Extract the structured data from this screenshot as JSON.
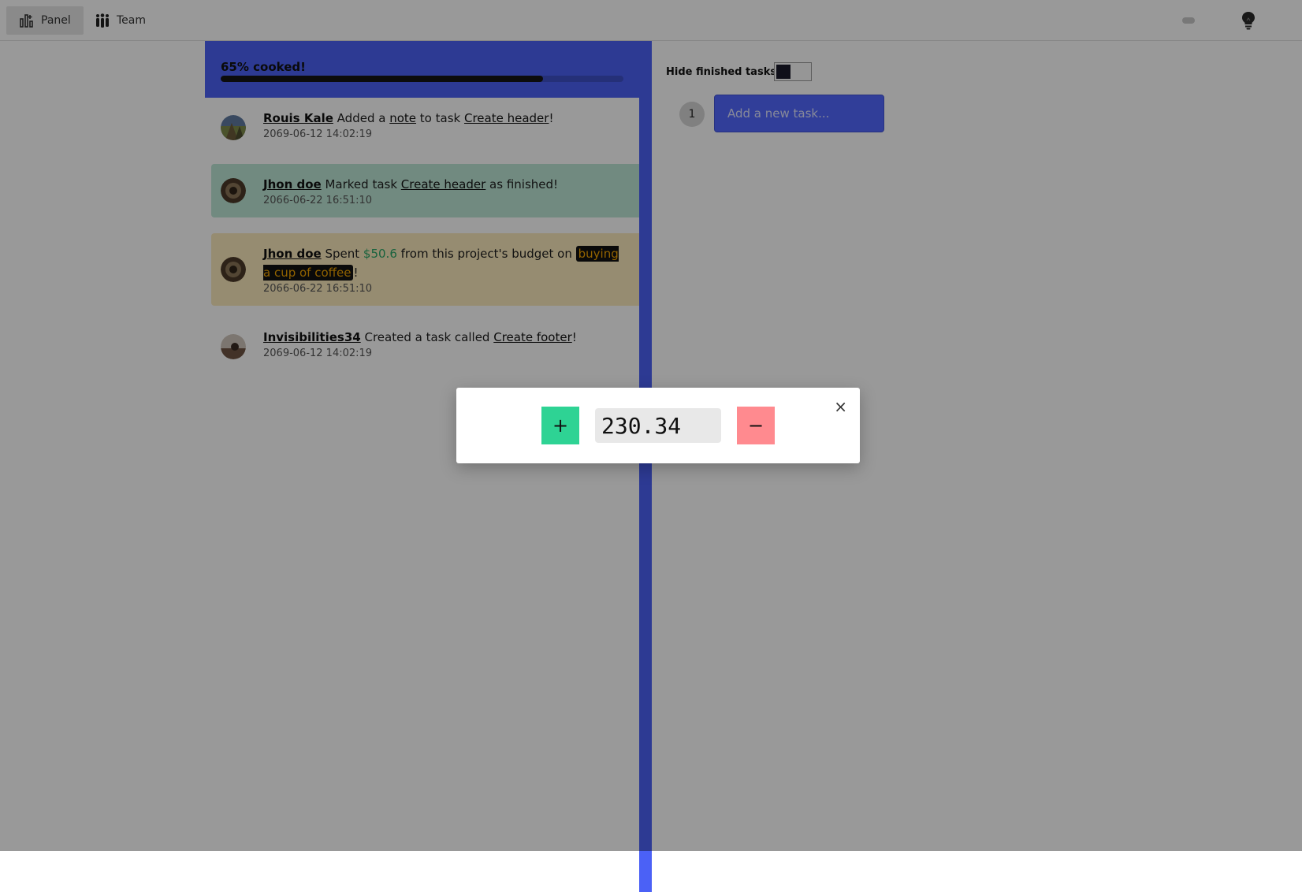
{
  "nav": {
    "items": [
      {
        "label": "Panel",
        "icon": "chart-bar-icon",
        "active": true
      },
      {
        "label": "Team",
        "icon": "team-icon",
        "active": false
      }
    ],
    "right_icons": [
      "toggle-pill-icon",
      "lightbulb-icon"
    ]
  },
  "progress": {
    "label": "65% cooked!",
    "fraction": 0.8
  },
  "feed": {
    "events": [
      {
        "user": "Rouis Kale",
        "pre": "Added a",
        "link1": "note",
        "mid": "to task",
        "link2": "Create header",
        "post": "!",
        "time": "2069-06-12 14:02:19"
      },
      {
        "user": "Jhon doe",
        "pre": "Marked task",
        "link": "Create header",
        "post": "as finished!",
        "time": "2066-06-22 16:51:10"
      },
      {
        "user": "Jhon doe",
        "pre": "Spent",
        "amount": "$50.6",
        "mid": "from this project's budget on",
        "item": "buying a cup of coffee",
        "post": "!",
        "time": "2066-06-22 16:51:10"
      },
      {
        "user": "Invisibilities34",
        "pre": "Created a task called",
        "link": "Create footer",
        "post": "!",
        "time": "2069-06-12 14:02:19"
      }
    ]
  },
  "tasks": {
    "hide_finished_label": "Hide finished tasks",
    "hide_finished_on": false,
    "new_task_number": "1",
    "new_task_placeholder": "Add a new task..."
  },
  "modal": {
    "amount": "230.34",
    "plus_label": "+",
    "minus_label": "−",
    "close_label": "×"
  },
  "colors": {
    "accent": "#4b61f6",
    "finished_bg": "#bde6d6",
    "spent_bg": "#fbeabc",
    "money": "#2aa568",
    "plus_button": "#2ed394",
    "minus_button": "#ff8a8f"
  }
}
